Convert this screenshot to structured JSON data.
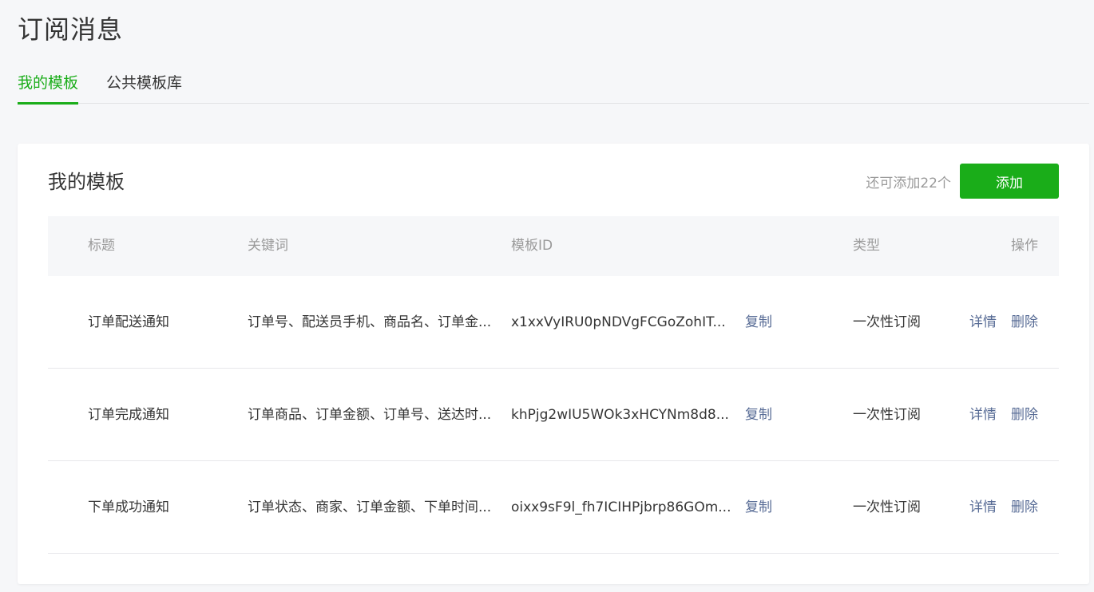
{
  "page_title": "订阅消息",
  "tabs": [
    {
      "label": "我的模板",
      "active": true
    },
    {
      "label": "公共模板库",
      "active": false
    }
  ],
  "card": {
    "title": "我的模板",
    "remaining_text": "还可添加22个",
    "add_label": "添加"
  },
  "table": {
    "headers": {
      "title": "标题",
      "keywords": "关键词",
      "template_id": "模板ID",
      "type": "类型",
      "ops": "操作"
    },
    "rows": [
      {
        "title": "订单配送通知",
        "keywords": "订单号、配送员手机、商品名、订单金...",
        "template_id": "x1xxVyIRU0pNDVgFCGoZohIT...",
        "copy": "复制",
        "type": "一次性订阅",
        "detail": "详情",
        "delete": "删除"
      },
      {
        "title": "订单完成通知",
        "keywords": "订单商品、订单金额、订单号、送达时...",
        "template_id": "khPjg2wIU5WOk3xHCYNm8d8...",
        "copy": "复制",
        "type": "一次性订阅",
        "detail": "详情",
        "delete": "删除"
      },
      {
        "title": "下单成功通知",
        "keywords": "订单状态、商家、订单金额、下单时间...",
        "template_id": "oixx9sF9l_fh7ICIHPjbrp86GOm...",
        "copy": "复制",
        "type": "一次性订阅",
        "detail": "详情",
        "delete": "删除"
      }
    ]
  },
  "colors": {
    "accent": "#1aad19",
    "link": "#576b95",
    "muted": "#9a9a9a",
    "background": "#f6f7f9"
  }
}
